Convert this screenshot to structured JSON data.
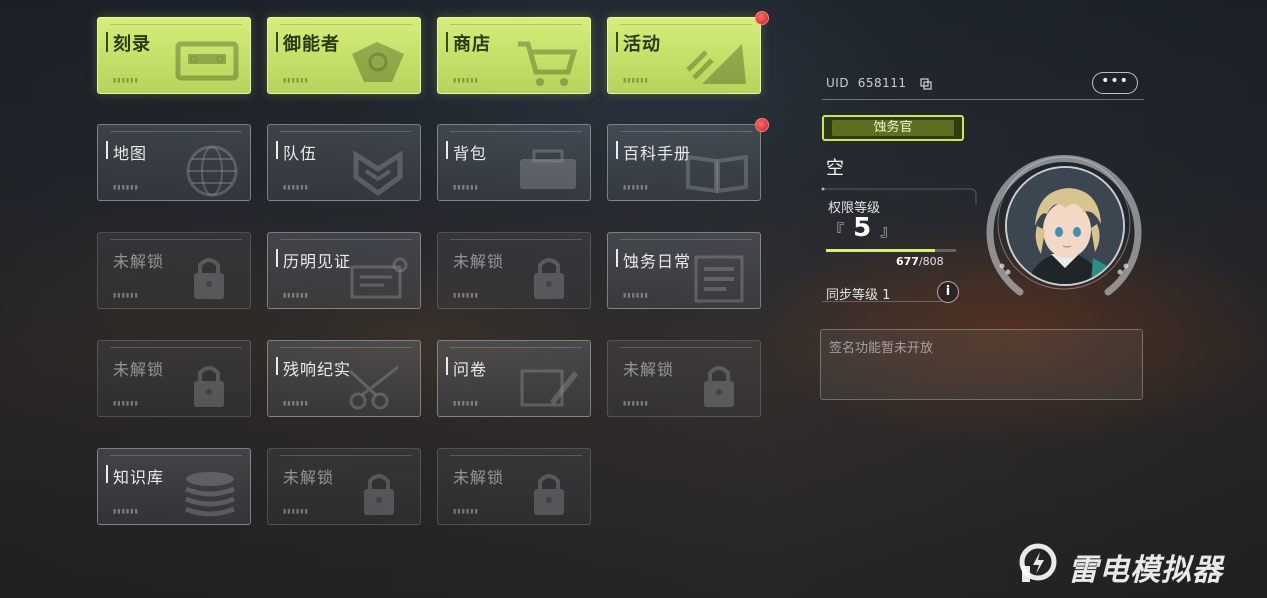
{
  "menu": {
    "tiles": [
      {
        "label": "刻录",
        "style": "primary",
        "icon": "tape-icon"
      },
      {
        "label": "御能者",
        "style": "primary",
        "icon": "badge-icon"
      },
      {
        "label": "商店",
        "style": "primary",
        "icon": "cart-icon"
      },
      {
        "label": "活动",
        "style": "primary",
        "icon": "flag-icon",
        "notification": true
      },
      {
        "label": "地图",
        "style": "normal",
        "icon": "globe-icon"
      },
      {
        "label": "队伍",
        "style": "normal",
        "icon": "shield-icon"
      },
      {
        "label": "背包",
        "style": "normal",
        "icon": "bag-icon"
      },
      {
        "label": "百科手册",
        "style": "normal",
        "icon": "book-icon",
        "notification": true
      },
      {
        "label": "未解锁",
        "style": "locked",
        "icon": "lock-icon"
      },
      {
        "label": "历明见证",
        "style": "normal",
        "icon": "document-icon"
      },
      {
        "label": "未解锁",
        "style": "locked",
        "icon": "lock-icon"
      },
      {
        "label": "蚀务日常",
        "style": "normal",
        "icon": "list-icon"
      },
      {
        "label": "未解锁",
        "style": "locked",
        "icon": "lock-icon"
      },
      {
        "label": "残响纪实",
        "style": "normal",
        "icon": "scissors-icon"
      },
      {
        "label": "问卷",
        "style": "normal",
        "icon": "pencil-icon"
      },
      {
        "label": "未解锁",
        "style": "locked",
        "icon": "lock-icon"
      },
      {
        "label": "知识库",
        "style": "normal",
        "icon": "database-icon"
      },
      {
        "label": "未解锁",
        "style": "locked",
        "icon": "lock-icon"
      },
      {
        "label": "未解锁",
        "style": "locked",
        "icon": "lock-icon"
      }
    ]
  },
  "profile": {
    "uid_label": "UID",
    "uid": "658111",
    "more_label": "•••",
    "title_badge": "蚀务官",
    "name": "空",
    "level_label": "权限等级",
    "level": "5",
    "xp_current": "677",
    "xp_max": "/808",
    "xp_fraction": 0.838,
    "sync_label": "同步等级",
    "sync_level": "1",
    "info_label": "i",
    "signature_placeholder": "签名功能暂未开放"
  },
  "watermark": {
    "text": "雷电模拟器"
  },
  "colors": {
    "accent": "#d6ee7c",
    "notification": "#e02424"
  }
}
